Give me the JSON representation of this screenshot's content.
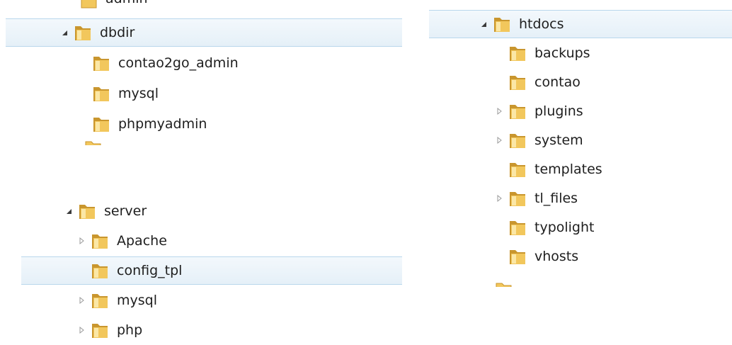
{
  "panel_top_left": {
    "partial_above": "admin",
    "items": [
      {
        "label": "dbdir",
        "state": "expanded",
        "selected": true
      },
      {
        "label": "contao2go_admin",
        "state": "none",
        "selected": false
      },
      {
        "label": "mysql",
        "state": "none",
        "selected": false
      },
      {
        "label": "phpmyadmin",
        "state": "none",
        "selected": false
      }
    ]
  },
  "panel_bottom_left": {
    "items": [
      {
        "label": "server",
        "state": "expanded",
        "selected": false
      },
      {
        "label": "Apache",
        "state": "collapsed",
        "selected": false
      },
      {
        "label": "config_tpl",
        "state": "none",
        "selected": true
      },
      {
        "label": "mysql",
        "state": "collapsed",
        "selected": false
      },
      {
        "label": "php",
        "state": "collapsed",
        "selected": false
      }
    ]
  },
  "panel_right": {
    "items": [
      {
        "label": "htdocs",
        "state": "expanded",
        "selected": true
      },
      {
        "label": "backups",
        "state": "none",
        "selected": false
      },
      {
        "label": "contao",
        "state": "none",
        "selected": false
      },
      {
        "label": "plugins",
        "state": "collapsed",
        "selected": false
      },
      {
        "label": "system",
        "state": "collapsed",
        "selected": false
      },
      {
        "label": "templates",
        "state": "none",
        "selected": false
      },
      {
        "label": "tl_files",
        "state": "collapsed",
        "selected": false
      },
      {
        "label": "typolight",
        "state": "none",
        "selected": false
      },
      {
        "label": "vhosts",
        "state": "none",
        "selected": false
      }
    ]
  },
  "colors": {
    "selection_bg": "#e5f0f8",
    "selection_border": "#b9d7ec",
    "folder_body": "#f2c75c",
    "folder_dark": "#c9962e"
  },
  "icons": {
    "folder": "folder-icon",
    "expanded": "expanded-triangle-icon",
    "collapsed": "collapsed-triangle-icon"
  }
}
